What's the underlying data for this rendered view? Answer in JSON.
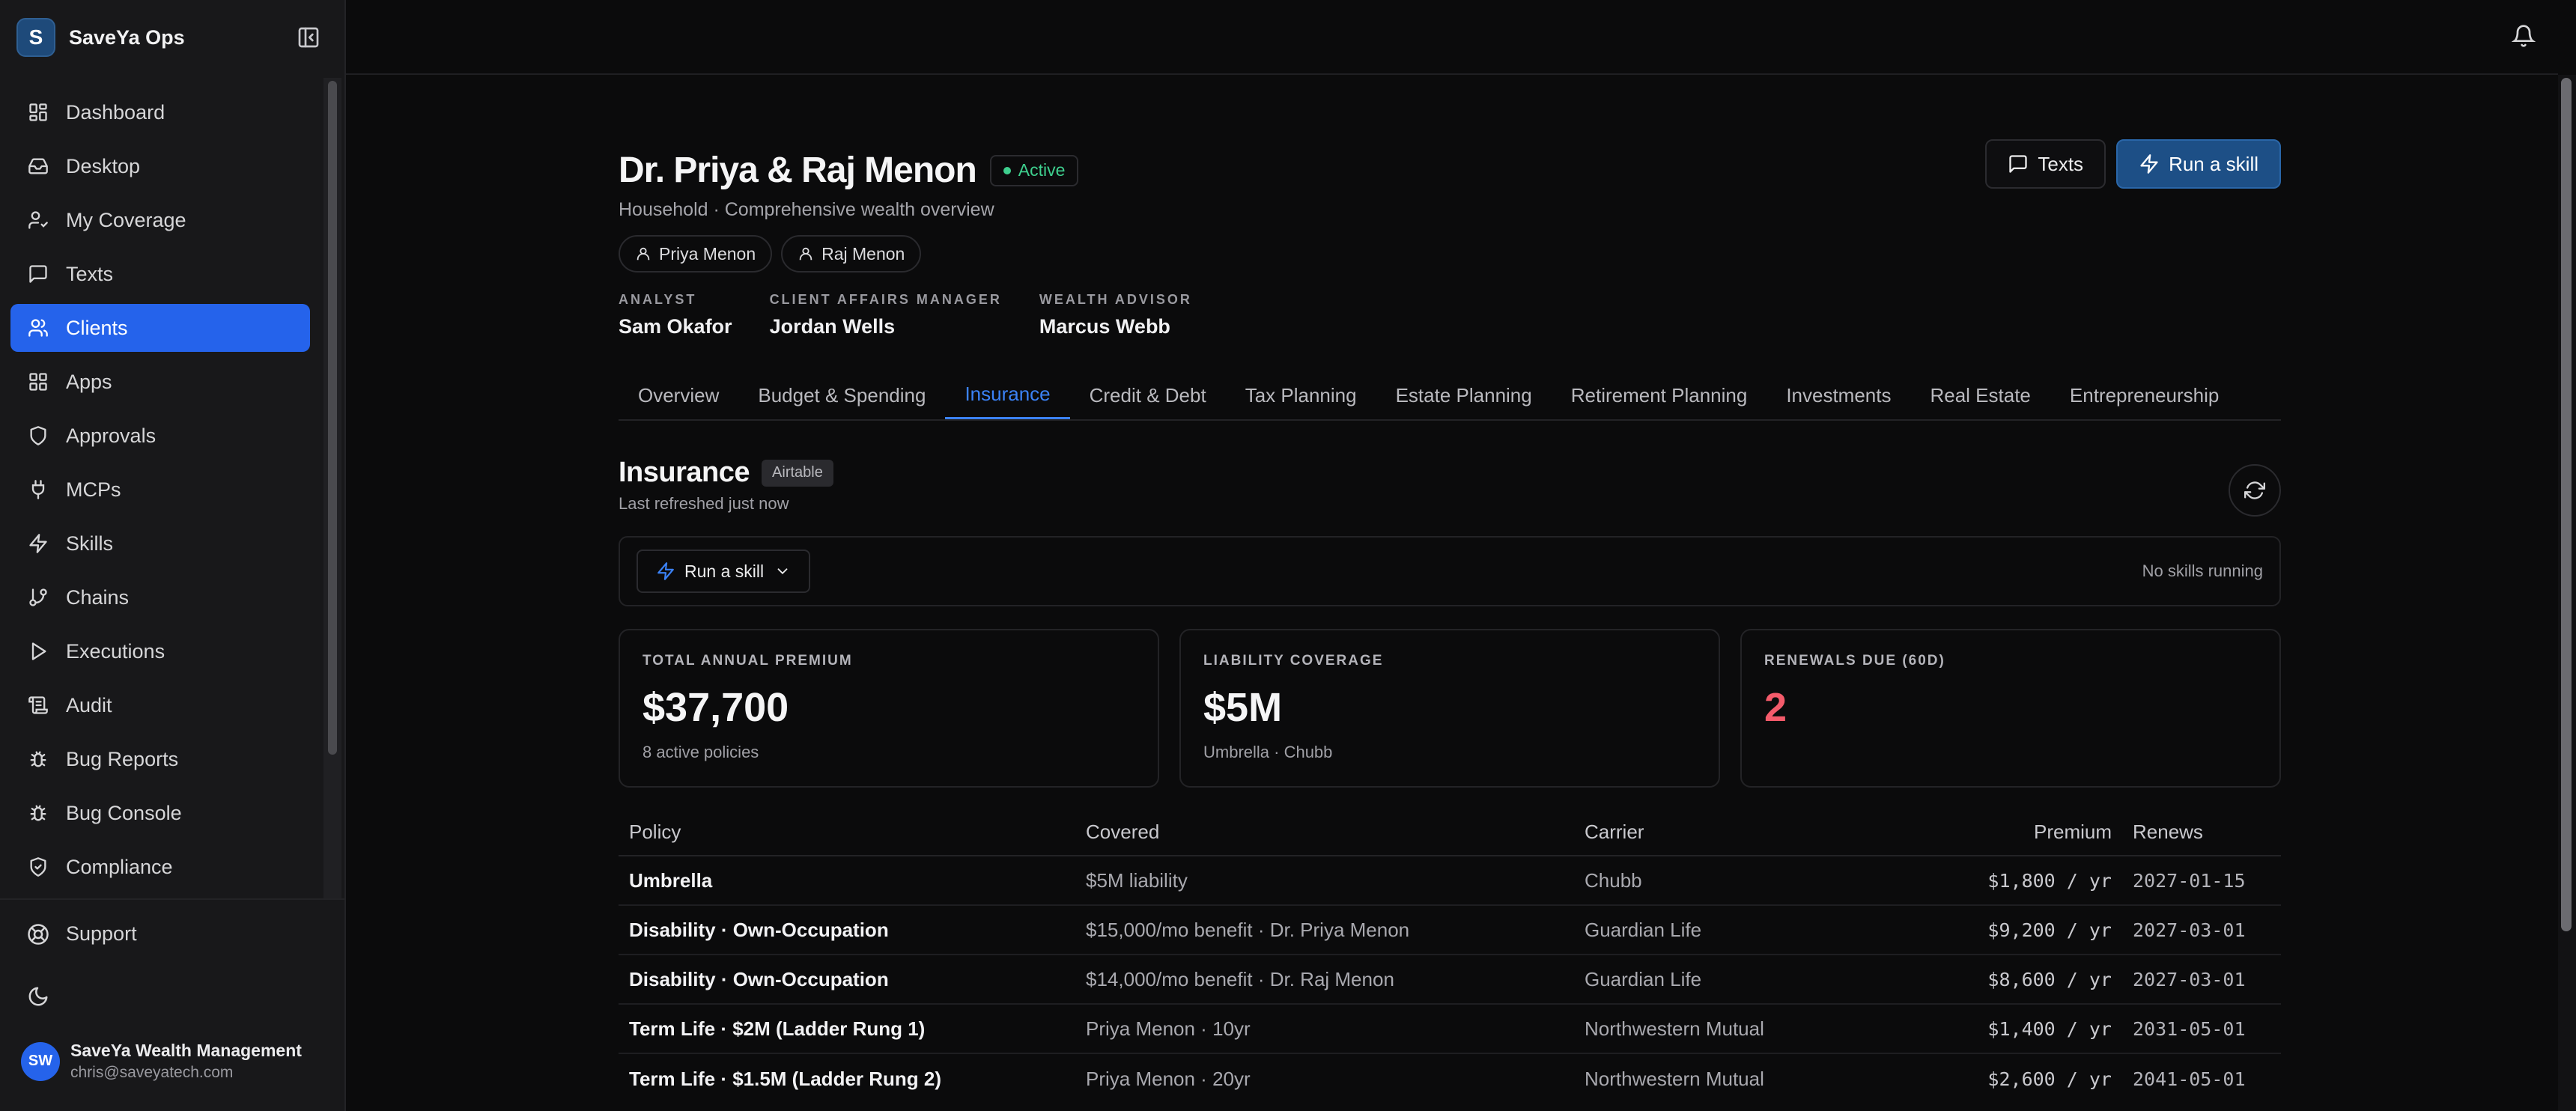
{
  "sidebar": {
    "brand_initial": "S",
    "brand_name": "SaveYa Ops",
    "items": [
      {
        "label": "Dashboard",
        "icon": "grid-icon"
      },
      {
        "label": "Desktop",
        "icon": "inbox-icon"
      },
      {
        "label": "My Coverage",
        "icon": "user-check-icon"
      },
      {
        "label": "Texts",
        "icon": "message-icon"
      },
      {
        "label": "Clients",
        "icon": "users-icon",
        "active": true
      },
      {
        "label": "Apps",
        "icon": "apps-icon"
      },
      {
        "label": "Approvals",
        "icon": "shield-icon"
      },
      {
        "label": "MCPs",
        "icon": "plug-icon"
      },
      {
        "label": "Skills",
        "icon": "zap-icon"
      },
      {
        "label": "Chains",
        "icon": "git-branch-icon"
      },
      {
        "label": "Executions",
        "icon": "play-icon"
      },
      {
        "label": "Audit",
        "icon": "scroll-icon"
      },
      {
        "label": "Bug Reports",
        "icon": "bug-icon"
      },
      {
        "label": "Bug Console",
        "icon": "bug-icon"
      },
      {
        "label": "Compliance",
        "icon": "shield-check-icon"
      }
    ],
    "support_label": "Support",
    "user": {
      "initials": "SW",
      "name": "SaveYa Wealth Management",
      "email": "chris@saveyatech.com"
    }
  },
  "header": {
    "title": "Dr. Priya & Raj Menon",
    "status": "Active",
    "subtitle": "Household · Comprehensive wealth overview",
    "members": [
      "Priya Menon",
      "Raj Menon"
    ],
    "roles": [
      {
        "label": "ANALYST",
        "name": "Sam Okafor"
      },
      {
        "label": "CLIENT AFFAIRS MANAGER",
        "name": "Jordan Wells"
      },
      {
        "label": "WEALTH ADVISOR",
        "name": "Marcus Webb"
      }
    ],
    "texts_label": "Texts",
    "run_skill_label": "Run a skill"
  },
  "tabs": [
    {
      "label": "Overview"
    },
    {
      "label": "Budget & Spending"
    },
    {
      "label": "Insurance",
      "active": true
    },
    {
      "label": "Credit & Debt"
    },
    {
      "label": "Tax Planning"
    },
    {
      "label": "Estate Planning"
    },
    {
      "label": "Retirement Planning"
    },
    {
      "label": "Investments"
    },
    {
      "label": "Real Estate"
    },
    {
      "label": "Entrepreneurship"
    }
  ],
  "section": {
    "title": "Insurance",
    "source": "Airtable",
    "refreshed": "Last refreshed just now",
    "skill_dropdown": "Run a skill",
    "skills_status": "No skills running"
  },
  "cards": [
    {
      "label": "TOTAL ANNUAL PREMIUM",
      "value": "$37,700",
      "sub": "8 active policies"
    },
    {
      "label": "LIABILITY COVERAGE",
      "value": "$5M",
      "sub": "Umbrella · Chubb"
    },
    {
      "label": "RENEWALS DUE (60D)",
      "value": "2",
      "sub": ""
    }
  ],
  "table": {
    "headers": {
      "policy": "Policy",
      "covered": "Covered",
      "carrier": "Carrier",
      "premium": "Premium",
      "renews": "Renews"
    },
    "rows": [
      {
        "policy": "Umbrella",
        "covered": "$5M liability",
        "carrier": "Chubb",
        "premium": "$1,800 / yr",
        "renews": "2027-01-15"
      },
      {
        "policy": "Disability · Own-Occupation",
        "covered": "$15,000/mo benefit · Dr. Priya Menon",
        "carrier": "Guardian Life",
        "premium": "$9,200 / yr",
        "renews": "2027-03-01"
      },
      {
        "policy": "Disability · Own-Occupation",
        "covered": "$14,000/mo benefit · Dr. Raj Menon",
        "carrier": "Guardian Life",
        "premium": "$8,600 / yr",
        "renews": "2027-03-01"
      },
      {
        "policy": "Term Life · $2M (Ladder Rung 1)",
        "covered": "Priya Menon · 10yr",
        "carrier": "Northwestern Mutual",
        "premium": "$1,400 / yr",
        "renews": "2031-05-01"
      },
      {
        "policy": "Term Life · $1.5M (Ladder Rung 2)",
        "covered": "Priya Menon · 20yr",
        "carrier": "Northwestern Mutual",
        "premium": "$2,600 / yr",
        "renews": "2041-05-01"
      }
    ]
  },
  "colors": {
    "accent": "#2563eb",
    "status_active": "#3ecf8e",
    "danger": "#f45b6b",
    "run_button": "#1d4f86"
  }
}
